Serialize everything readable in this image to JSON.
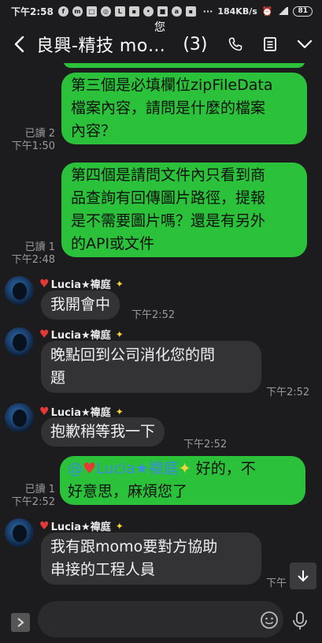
{
  "statusbar": {
    "time": "下午2:58",
    "speed": "184KB/s",
    "battery": "81"
  },
  "ghost_text": "您",
  "header": {
    "title": "良興-精技 mo…",
    "member_count": "(3)"
  },
  "messages": {
    "out1": {
      "lines": [
        "第三個是必填欄位zipFileData",
        "檔案內容，請問是什麼的檔案",
        "內容？"
      ],
      "read": "已讀 2",
      "time": "下午1:50"
    },
    "out2": {
      "lines": [
        "第四個是請問文件內只看到商",
        "品查詢有回傳圖片路徑，提報",
        "是不需要圖片嗎？還是有另外",
        "的API或文件"
      ],
      "read": "已讀 1",
      "time": "下午2:48"
    },
    "in1": {
      "sender": "Lucia★禕庭",
      "lines": [
        "我開會中"
      ],
      "time": "下午2:52"
    },
    "in2": {
      "sender": "Lucia★禕庭",
      "lines": [
        "晚點回到公司消化您的問",
        "題"
      ],
      "time": "下午2:52"
    },
    "in3": {
      "sender": "Lucia★禕庭",
      "lines": [
        "抱歉稍等我一下"
      ],
      "time": "下午2:52"
    },
    "out3": {
      "mention": "@❤️Lucia★禕庭✨",
      "mention_name": "Lucia★禕庭",
      "text_line1": " 好的，不",
      "text_line2": "好意思，麻煩您了",
      "read": "已讀 1",
      "time": "下午2:52"
    },
    "in4": {
      "sender": "Lucia★禕庭",
      "lines": [
        "我有跟momo要對方協助",
        "串接的工程人員"
      ],
      "time": "下午"
    }
  },
  "input": {
    "placeholder": ""
  }
}
